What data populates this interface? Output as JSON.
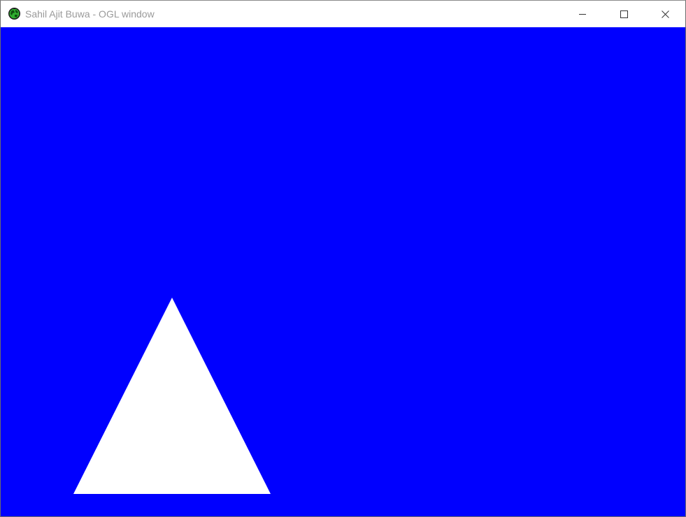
{
  "window": {
    "title": "Sahil Ajit Buwa - OGL window",
    "app_icon": "globe-icon",
    "controls": {
      "minimize_icon": "minimize-icon",
      "maximize_icon": "maximize-icon",
      "close_icon": "close-icon"
    }
  },
  "scene": {
    "clear_color": "#0000ff",
    "shape": "triangle",
    "shape_color": "#ffffff"
  }
}
